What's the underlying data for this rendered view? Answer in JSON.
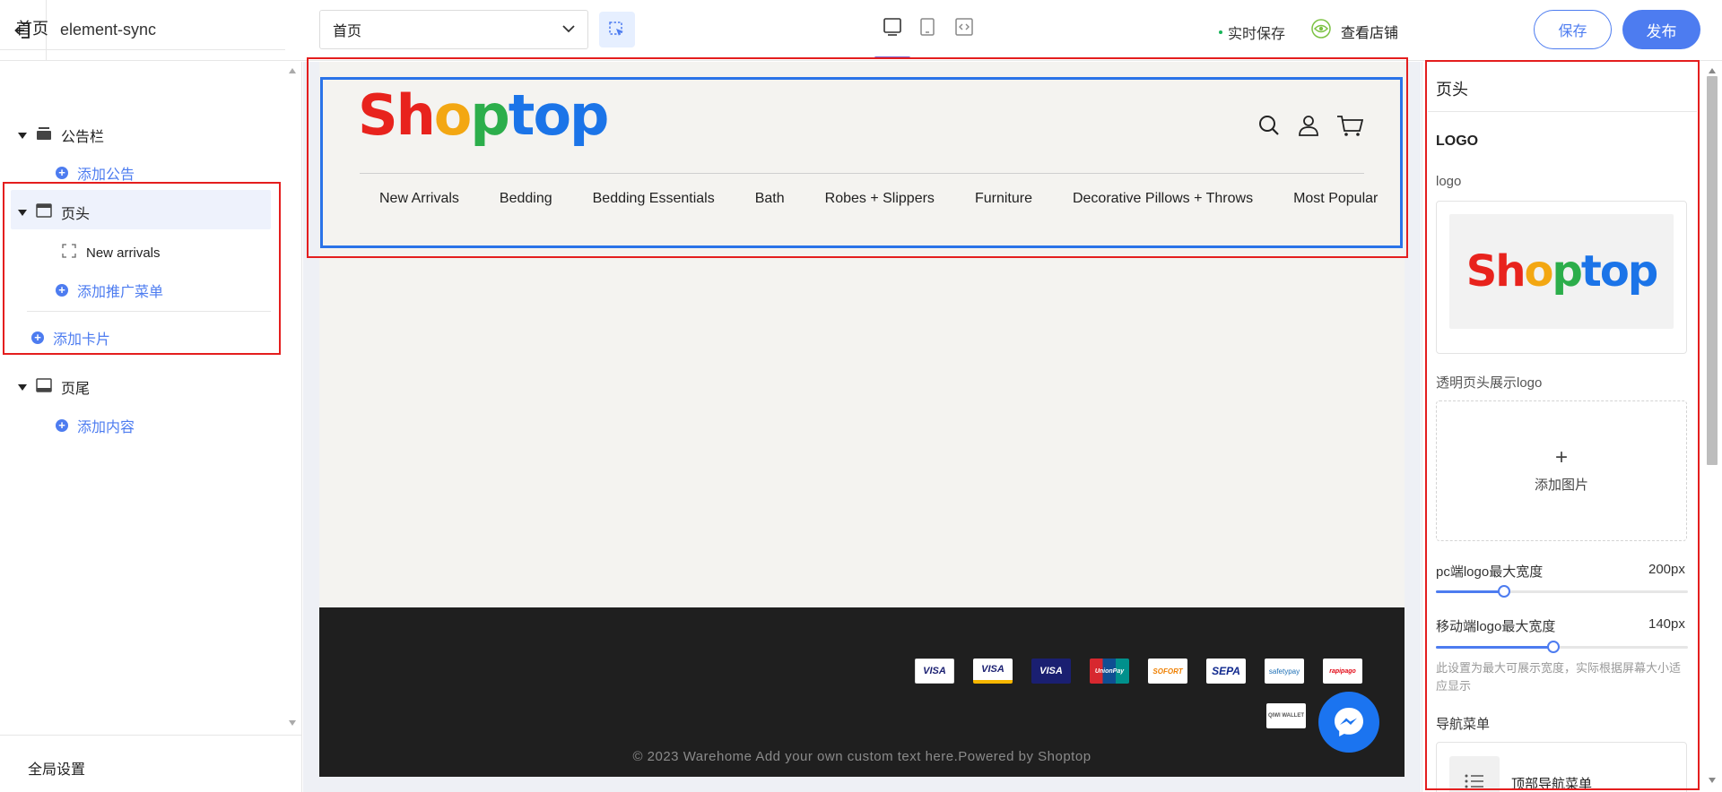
{
  "app": {
    "title": "element-sync"
  },
  "toolbar": {
    "page_select_value": "首页",
    "autosave_label": "实时保存",
    "view_store_label": "查看店铺",
    "save_label": "保存",
    "publish_label": "发布",
    "active_device": "desktop"
  },
  "left_panel": {
    "title": "首页",
    "sections": {
      "announcement": {
        "label": "公告栏",
        "add_label": "添加公告"
      },
      "header": {
        "label": "页头",
        "child_label": "New arrivals",
        "add_menu_label": "添加推广菜单",
        "add_card_label": "添加卡片"
      },
      "footer": {
        "label": "页尾",
        "add_label": "添加内容"
      }
    },
    "global_settings_label": "全局设置"
  },
  "store": {
    "logo": {
      "letters": [
        "S",
        "h",
        "o",
        "p",
        "t",
        "o",
        "p"
      ],
      "colors": [
        "#e8231d",
        "#e8231d",
        "#f3a712",
        "#2cae4b",
        "#1b74e8",
        "#1b74e8",
        "#1b74e8"
      ]
    },
    "nav": [
      "New Arrivals",
      "Bedding",
      "Bedding Essentials",
      "Bath",
      "Robes + Slippers",
      "Furniture",
      "Decorative Pillows + Throws",
      "Most Popular"
    ],
    "payments_row1": [
      "VISA",
      "VISA",
      "VISA",
      "UnionPay",
      "SOFORT",
      "SEPA",
      "safetypay",
      "rapipago"
    ],
    "payments_row2": [
      "QIWI WALLET"
    ],
    "copyright": "© 2023 Warehome Add your own custom text here.Powered by Shoptop"
  },
  "right_panel": {
    "title": "页头",
    "logo_heading": "LOGO",
    "logo_label": "logo",
    "transparent_logo_label": "透明页头展示logo",
    "add_image_label": "添加图片",
    "pc_logo_width": {
      "label": "pc端logo最大宽度",
      "value": "200px",
      "fraction": 0.27
    },
    "mobile_logo_width": {
      "label": "移动端logo最大宽度",
      "value": "140px",
      "fraction": 0.465
    },
    "hint": "此设置为最大可展示宽度，实际根据屏幕大小适应显示",
    "nav_menu_label": "导航菜单",
    "nav_menu_card_label": "顶部导航菜单"
  },
  "colors": {
    "accent": "#4d7cf0",
    "highlight_red": "#e41e1e",
    "selection_blue": "#2a73e8",
    "footer_bg": "#1f1f1f"
  }
}
